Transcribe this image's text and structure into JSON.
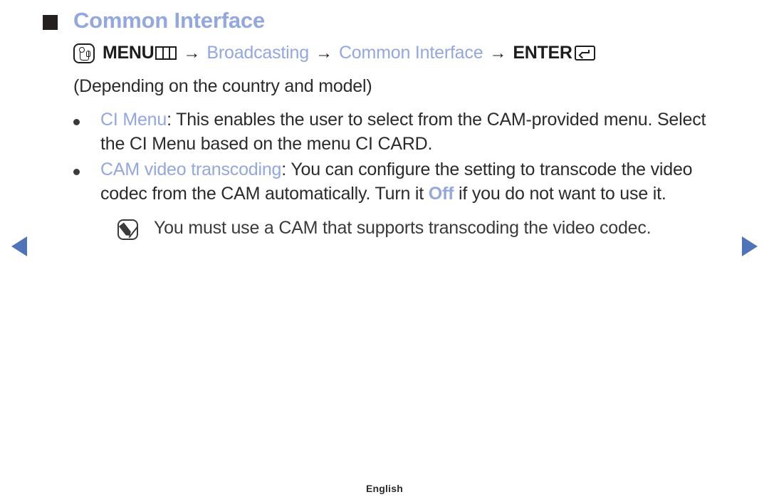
{
  "accent_color": "#93a7e0",
  "text_color": "#2b2b2b",
  "arrow_color": "#4f74b8",
  "title": "Common Interface",
  "menu_path": {
    "hand_icon": "hand-press-icon",
    "menu_label": "MENU",
    "menu_icon": "menu-grid-icon",
    "arrow1": "→",
    "broadcasting": "Broadcasting",
    "arrow2": "→",
    "common_interface": "Common Interface",
    "arrow3": "→",
    "enter_label": "ENTER",
    "enter_icon": "enter-key-icon"
  },
  "note_paragraph": "(Depending on the country and model)",
  "bullets": [
    {
      "term": "CI Menu",
      "separator": ": ",
      "body": "This enables the user to select from the CAM-provided menu. Select the CI Menu based on the menu CI CARD."
    },
    {
      "term": "CAM video transcoding",
      "separator": ": ",
      "body_before": "You can configure the setting to transcode the video codec from the CAM automatically. Turn it ",
      "highlight": "Off",
      "body_after": " if you do not want to use it."
    }
  ],
  "note": {
    "icon": "note-pencil-icon",
    "text": "You must use a CAM that supports transcoding the video codec."
  },
  "nav": {
    "prev_icon": "prev-page-arrow-icon",
    "next_icon": "next-page-arrow-icon"
  },
  "footer": "English"
}
